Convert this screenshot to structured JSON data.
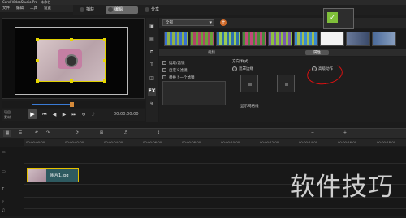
{
  "window": {
    "title": "Corel VideoStudio Pro - 未命名"
  },
  "menu": [
    "文件",
    "编辑",
    "工具",
    "设置"
  ],
  "steps": {
    "capture": "捕获",
    "edit": "编辑",
    "share": "分享"
  },
  "preview": {
    "mode_labels": [
      "项目",
      "素材"
    ],
    "timecode": "00:00:00:00"
  },
  "library": {
    "dropdown_value": "全部",
    "tabs": [
      "视频",
      "属性"
    ]
  },
  "options": {
    "replace_last": "替换上一个滤镜",
    "effect_1": "选取/滤镜",
    "effect_2": "自定义滤镜",
    "direction_title": "方向/样式",
    "radio_1": "遮罩边缘",
    "radio_2": "遮罩/边框",
    "basic_motion": "基本动作",
    "advanced_motion": "高级动作",
    "show_grid": "显示网格线"
  },
  "timeline": {
    "ruler": [
      "00:00:00:00",
      "00:00:02:00",
      "00:00:04:00",
      "00:00:06:00",
      "00:00:08:00",
      "00:00:10:00",
      "00:00:12:00",
      "00:00:14:00",
      "00:00:16:00",
      "00:00:18:00"
    ],
    "clip_name": "图片1.jpg"
  },
  "watermark": "软件技巧"
}
